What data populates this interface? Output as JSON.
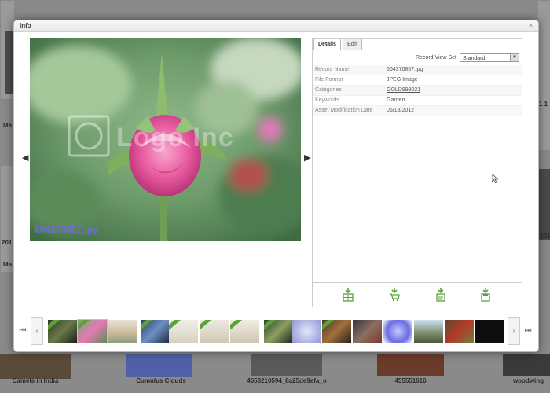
{
  "modal": {
    "title": "Info"
  },
  "preview": {
    "caption": "604370857.jpg",
    "watermark": "Logo Inc"
  },
  "details": {
    "tabs": [
      {
        "label": "Details",
        "active": true
      },
      {
        "label": "Edit",
        "active": false
      }
    ],
    "record_view_set": {
      "label": "Record View Set",
      "value": "Standard"
    },
    "fields": [
      {
        "label": "Record Name",
        "value": "604370857.jpg"
      },
      {
        "label": "File Format",
        "value": "JPEG Image"
      },
      {
        "label": "Categories",
        "value": "GOLD999021"
      },
      {
        "label": "Keywords",
        "value": "Garden"
      },
      {
        "label": "Asset Modification Date",
        "value": "06/18/2012"
      }
    ],
    "actions": [
      "layout-icon",
      "cart-download-icon",
      "document-download-icon",
      "disk-download-icon"
    ]
  },
  "background": {
    "captions": [
      "Camels in India",
      "Cumulus Clouds",
      "4658210594_8a25de9efa_o",
      "455551616",
      "woodwing"
    ],
    "side_labels": [
      "Ma",
      "201",
      "Ma",
      "1 1",
      "201"
    ]
  },
  "filmstrip": {
    "count": 15,
    "selected_index": 1
  },
  "colors": {
    "accent_green": "#5da13a",
    "caption_purple": "#6d6cd8"
  }
}
